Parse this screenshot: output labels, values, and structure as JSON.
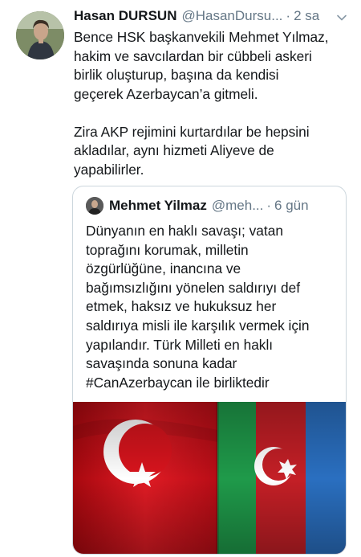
{
  "tweet": {
    "display_name": "Hasan DURSUN",
    "handle": "@HasanDursu...",
    "separator": "·",
    "time": "2 sa",
    "icons": {
      "menu": "chevron-down-icon"
    },
    "text": "Bence HSK başkanvekili Mehmet Yılmaz,\nhakim ve savcılardan bir cübbeli askeri\nbirlik oluşturup, başına da kendisi\ngeçerek Azerbaycan’a gitmeli.\n\nZira AKP rejimini kurtardılar be hepsini\nakladılar, aynı hizmeti Aliyeve de\nyapabilirler."
  },
  "quoted_tweet": {
    "display_name": "Mehmet Yilmaz",
    "handle": "@meh...",
    "separator": "·",
    "time": "6 gün",
    "text": "Dünyanın en haklı savaşı; vatan\ntoprağını korumak, milletin\nözgürlüğüne, inancına ve\nbağımsızlığını yönelen saldırıyı def\netmek, haksız ve hukuksuz her\nsaldırıya misli ile karşılık vermek için\nyapılandır. Türk Milleti en haklı\nsavaşında sonuna kadar\n#CanAzerbaycan ile birliktedir",
    "media": {
      "subject": "Turkish and Azerbaijani flags side by side",
      "colors": {
        "turkey_red": "#d8141d",
        "az_blue": "#2a6fc0",
        "az_red": "#d42a2e",
        "az_green": "#1f9a4a"
      }
    }
  },
  "colors": {
    "text": "#14171a",
    "secondary": "#657786",
    "border": "#ccd6dd"
  }
}
